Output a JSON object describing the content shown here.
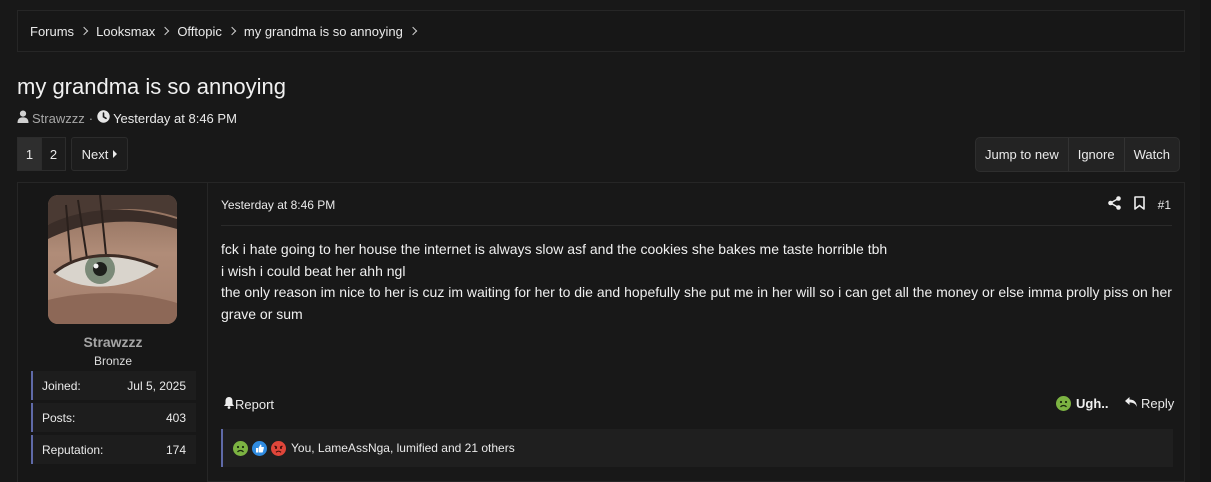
{
  "breadcrumb": {
    "items": [
      "Forums",
      "Looksmax",
      "Offtopic",
      "my grandma is so annoying"
    ]
  },
  "thread": {
    "title": "my grandma is so annoying",
    "author": "Strawzzz",
    "separator": "·",
    "date": "Yesterday at 8:46 PM"
  },
  "pagination": {
    "pages": [
      "1",
      "2"
    ],
    "current": "1",
    "next_label": "Next"
  },
  "thread_actions": {
    "jump_label": "Jump to new",
    "ignore_label": "Ignore",
    "watch_label": "Watch"
  },
  "user": {
    "name": "Strawzzz",
    "title": "Bronze",
    "stats": [
      {
        "label": "Joined:",
        "value": "Jul 5, 2025"
      },
      {
        "label": "Posts:",
        "value": "403"
      },
      {
        "label": "Reputation:",
        "value": "174"
      }
    ]
  },
  "post": {
    "date": "Yesterday at 8:46 PM",
    "number": "#1",
    "lines": [
      "fck i hate going to her house the internet is always slow asf and the cookies she bakes me taste horrible tbh",
      "i wish i could beat her ahh ngl",
      "the only reason im nice to her is cuz im waiting for her to die and hopefully she put me in her will so i can get all the money or else imma prolly piss on her grave or sum"
    ],
    "report_label": "Report",
    "reaction_label": "Ugh..",
    "reply_label": "Reply",
    "reactions_summary": "You, LameAssNga, lumified and 21 others"
  },
  "icons": [
    "user-icon",
    "clock-icon",
    "share-icon",
    "bookmark-icon",
    "bell-icon",
    "reply-icon",
    "ugh-reaction-icon",
    "like-reaction-icon",
    "angry-reaction-icon"
  ],
  "colors": {
    "background": "#181818",
    "accent_border": "#5f6aa8",
    "ugh_green": "#7cb342",
    "like_blue": "#2f8be0",
    "angry_red": "#e0463a"
  }
}
